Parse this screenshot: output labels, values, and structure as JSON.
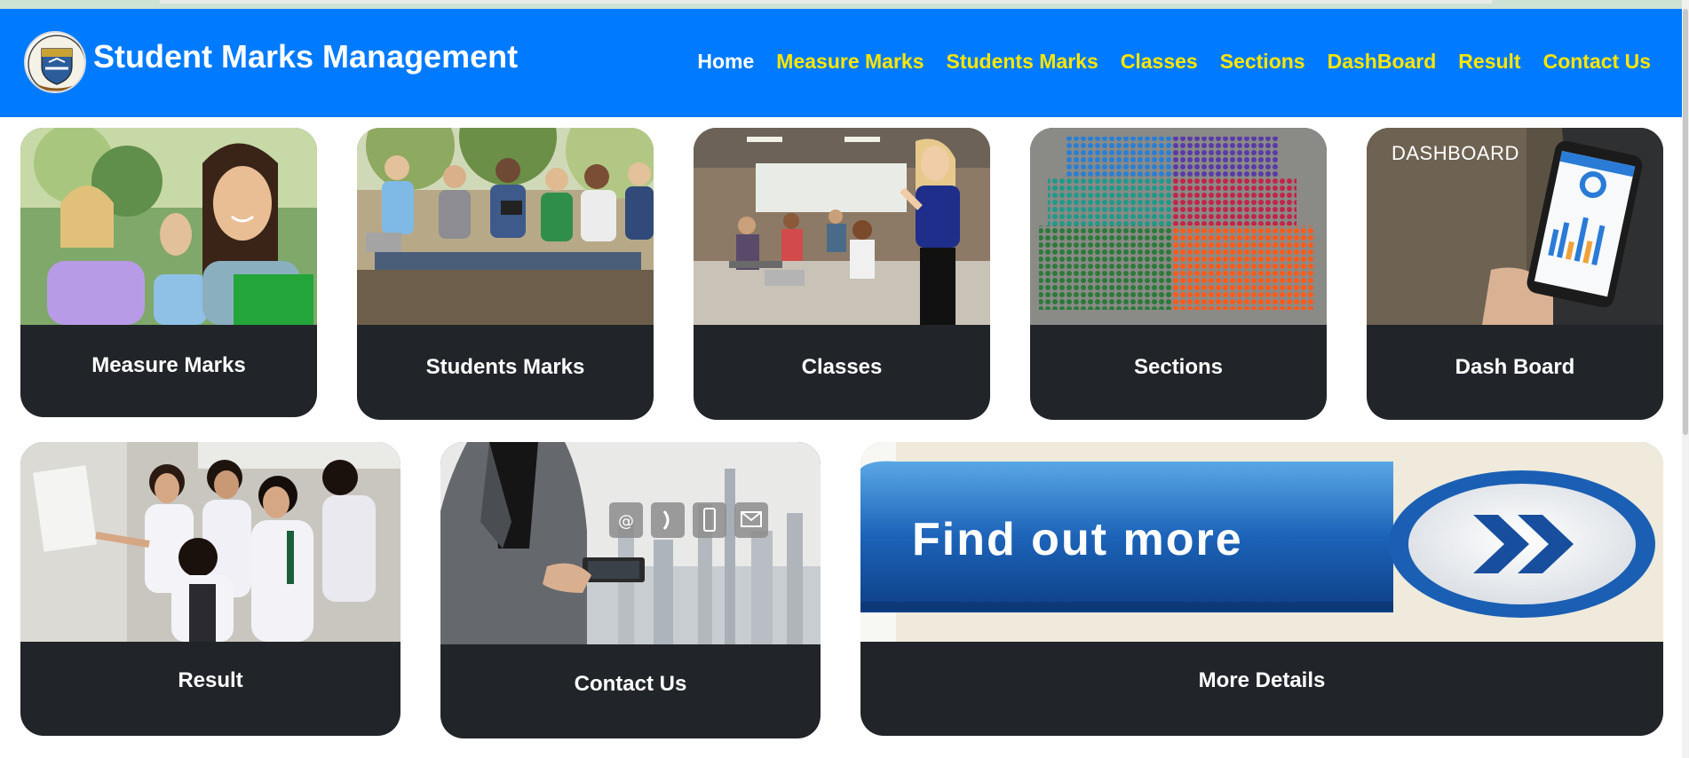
{
  "header": {
    "title": "Student Marks Management",
    "logo_icon": "university-crest-icon"
  },
  "nav": {
    "items": [
      {
        "label": "Home",
        "active": true
      },
      {
        "label": "Measure Marks"
      },
      {
        "label": "Students Marks"
      },
      {
        "label": "Classes"
      },
      {
        "label": "Sections"
      },
      {
        "label": "DashBoard"
      },
      {
        "label": "Result"
      },
      {
        "label": "Contact Us"
      }
    ]
  },
  "cards": [
    {
      "label": "Measure Marks",
      "image": "students-smiling-photo"
    },
    {
      "label": "Students Marks",
      "image": "students-sitting-photo"
    },
    {
      "label": "Classes",
      "image": "classroom-photo"
    },
    {
      "label": "Sections",
      "image": "student-groups-aerial-photo"
    },
    {
      "label": "Dash Board",
      "image": "dashboard-phone-photo",
      "overlay_text": "DASHBOARD"
    },
    {
      "label": "Result",
      "image": "students-reading-results-photo"
    },
    {
      "label": "Contact Us",
      "image": "businessman-tablet-photo"
    },
    {
      "label": "More Details",
      "image": "find-out-more-banner",
      "banner_text": "Find out more"
    }
  ],
  "colors": {
    "navbar": "#007bff",
    "nav_link": "#ffe600",
    "nav_active": "#ffffff",
    "card_bg": "#212529"
  }
}
